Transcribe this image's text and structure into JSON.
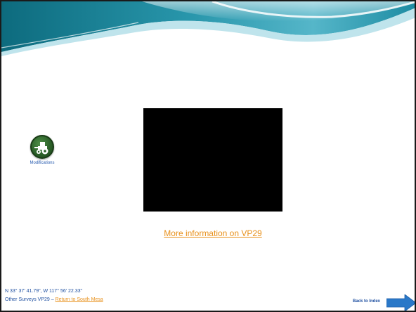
{
  "slide": {
    "modifications_label": "Modifications",
    "more_info_link": "More information on VP29",
    "coordinates": "N 33° 37' 41.79\", W 117° 56' 22.33\"",
    "surveys_prefix": "Other Surveys VP29 – ",
    "return_link": "Return to South Mesa",
    "back_to_index": "Back to Index"
  },
  "colors": {
    "banner_dark": "#0e6f80",
    "banner_light": "#7cc8d8",
    "link_orange": "#e8901a",
    "text_blue": "#1e4fa0",
    "arrow_blue": "#2a78c8",
    "icon_green": "#2c6129"
  },
  "icons": {
    "modifications": "tractor-icon",
    "back": "right-arrow-icon"
  }
}
